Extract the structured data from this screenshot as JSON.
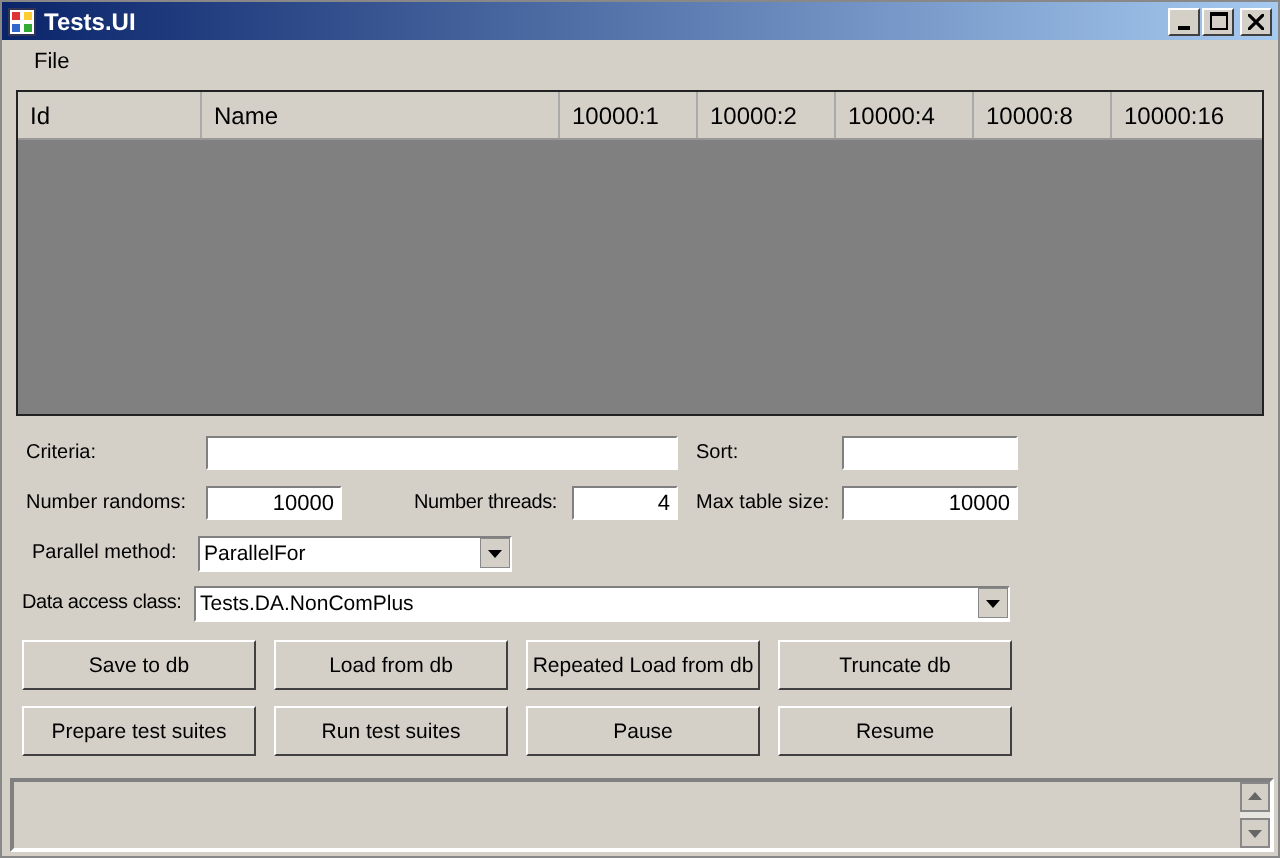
{
  "window": {
    "title": "Tests.UI"
  },
  "menu": [
    {
      "label": "File"
    }
  ],
  "table": {
    "columns": [
      "Id",
      "Name",
      "10000:1",
      "10000:2",
      "10000:4",
      "10000:8",
      "10000:16"
    ]
  },
  "form": {
    "rows": [
      {
        "fields": [
          {
            "label": "Criteria:",
            "kind": "text"
          },
          {
            "label": "Sort:",
            "kind": "text"
          }
        ]
      },
      {
        "fields": [
          {
            "label": "Number randoms:",
            "kind": "number",
            "value": "10000"
          },
          {
            "label": "Number threads:",
            "kind": "number",
            "value": "4"
          },
          {
            "label": "Max table size:",
            "kind": "number",
            "value": "10000"
          }
        ]
      },
      {
        "fields": [
          {
            "label": "Parallel method:",
            "kind": "dropdown",
            "value": "ParallelFor"
          }
        ]
      },
      {
        "fields": [
          {
            "label": "Data access class:",
            "kind": "dropdown",
            "value": "Tests.DA.NonComPlus"
          }
        ]
      }
    ]
  },
  "buttons": [
    [
      "Save to db",
      "Load from db",
      "Repeated Load from db",
      "Truncate db"
    ],
    [
      "Prepare test suites",
      "Run test suites",
      "Pause",
      "Resume"
    ]
  ],
  "log": {
    "kind": "textarea"
  }
}
